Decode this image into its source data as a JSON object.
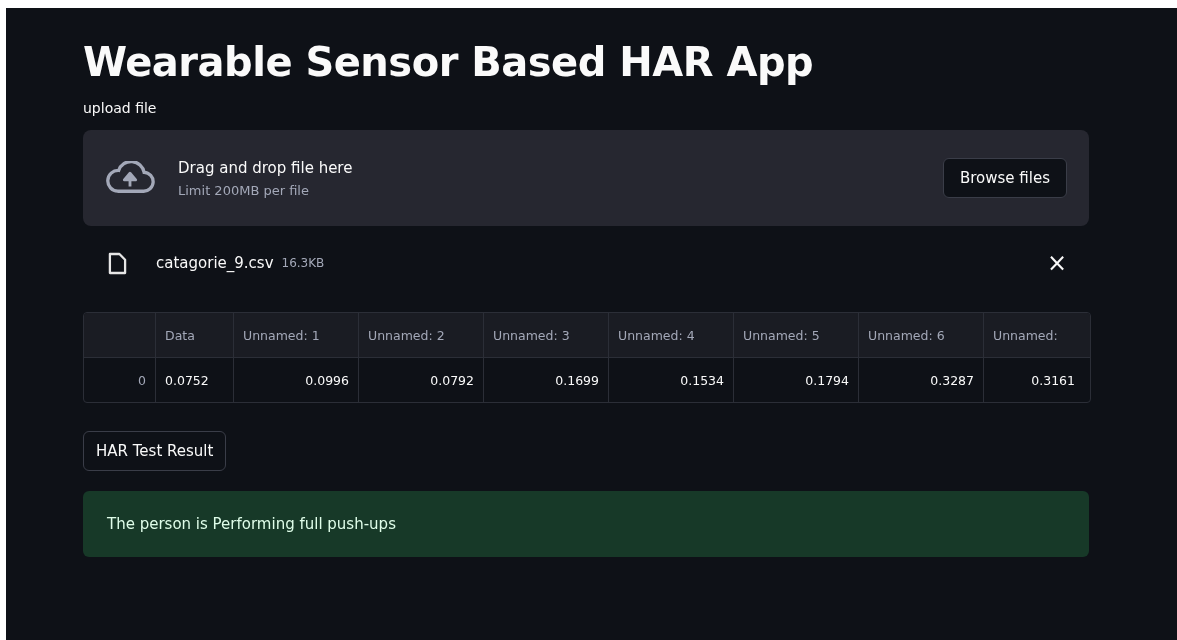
{
  "title": "Wearable Sensor Based HAR App",
  "uploader": {
    "label": "upload file",
    "drop_text": "Drag and drop file here",
    "limit_text": "Limit 200MB per file",
    "browse_button": "Browse files"
  },
  "file": {
    "name": "catagorie_9.csv",
    "size": "16.3KB",
    "remove": "×"
  },
  "table": {
    "columns": [
      "",
      "Data",
      "Unnamed: 1",
      "Unnamed: 2",
      "Unnamed: 3",
      "Unnamed: 4",
      "Unnamed: 5",
      "Unnamed: 6",
      "Unnamed:"
    ],
    "rows": [
      [
        "0",
        "0.0752",
        "0.0996",
        "0.0792",
        "0.1699",
        "0.1534",
        "0.1794",
        "0.3287",
        "0.3161"
      ]
    ]
  },
  "result_button": "HAR Test Result",
  "result_message": "The person is Performing full push-ups"
}
